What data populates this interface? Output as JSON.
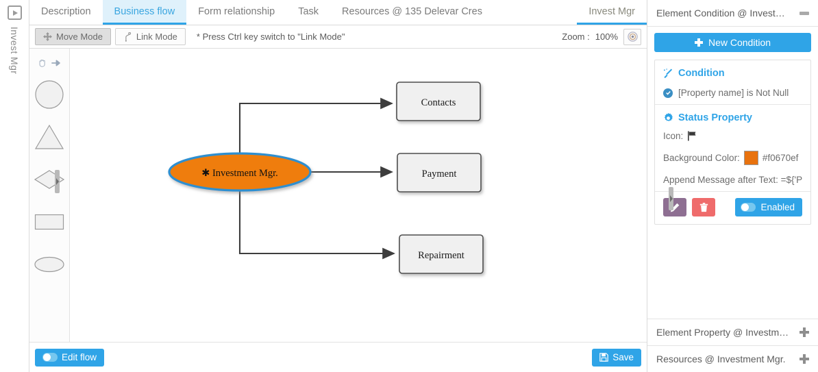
{
  "rail": {
    "icon": "play-square-icon",
    "label": "Invest Mgr"
  },
  "tabs": [
    {
      "label": "Description",
      "active": false
    },
    {
      "label": "Business flow",
      "active": true
    },
    {
      "label": "Form relationship",
      "active": false
    },
    {
      "label": "Task",
      "active": false
    },
    {
      "label": "Resources @ 135 Delevar Cres",
      "active": false
    }
  ],
  "right_tab": {
    "label": "Invest Mgr"
  },
  "toolbar": {
    "move_mode": "Move Mode",
    "link_mode": "Link Mode",
    "hint": "* Press Ctrl key switch to \"Link Mode\"",
    "zoom_label": "Zoom :",
    "zoom_value": "100%",
    "zoom_target_icon": "target-icon"
  },
  "palette": [
    {
      "name": "hand-tool",
      "icon": "hand-icon"
    },
    {
      "name": "arrow-tool",
      "icon": "arrow-right-icon"
    },
    {
      "name": "circle-shape",
      "icon": "circle-icon"
    },
    {
      "name": "triangle-shape",
      "icon": "triangle-icon"
    },
    {
      "name": "diamond-shape",
      "icon": "diamond-icon"
    },
    {
      "name": "rectangle-shape",
      "icon": "rectangle-icon"
    },
    {
      "name": "ellipse-shape",
      "icon": "ellipse-icon"
    }
  ],
  "diagram": {
    "start_node": {
      "label": "Investment Mgr.",
      "prefix_glyph": "✱",
      "fill": "#ef7d10",
      "stroke": "#2d8fd0"
    },
    "nodes": [
      {
        "label": "Contacts"
      },
      {
        "label": "Payment"
      },
      {
        "label": "Repairment"
      }
    ],
    "node_fill": "#f0f0f0",
    "node_stroke": "#4d4d4d"
  },
  "bottom_bar": {
    "edit_flow": "Edit flow",
    "save": "Save",
    "save_icon": "floppy-disk-icon"
  },
  "panel": {
    "header": {
      "title": "Element Condition @ Invest…",
      "minimize_icon": "minimize-icon"
    },
    "new_condition": "New Condition",
    "card": {
      "condition_title": "Condition",
      "condition_icon": "magic-wand-icon",
      "condition_text": "[Property name] is Not Null",
      "condition_check_icon": "check-circle-icon",
      "status_title": "Status Property",
      "status_icon": "gear-icon",
      "icon_label": "Icon:",
      "icon_value": "flag-icon",
      "bg_label": "Background Color:",
      "bg_value": "#f0670ef",
      "bg_swatch": "#e8720e",
      "append_label": "Append Message after Text: =${'P",
      "edit_icon": "pencil-icon",
      "delete_icon": "trash-icon",
      "enabled_label": "Enabled"
    },
    "sections": [
      {
        "title": "Element Property @ Investm…",
        "icon": "plus-icon"
      },
      {
        "title": "Resources @ Investment Mgr.",
        "icon": "plus-icon"
      }
    ]
  }
}
